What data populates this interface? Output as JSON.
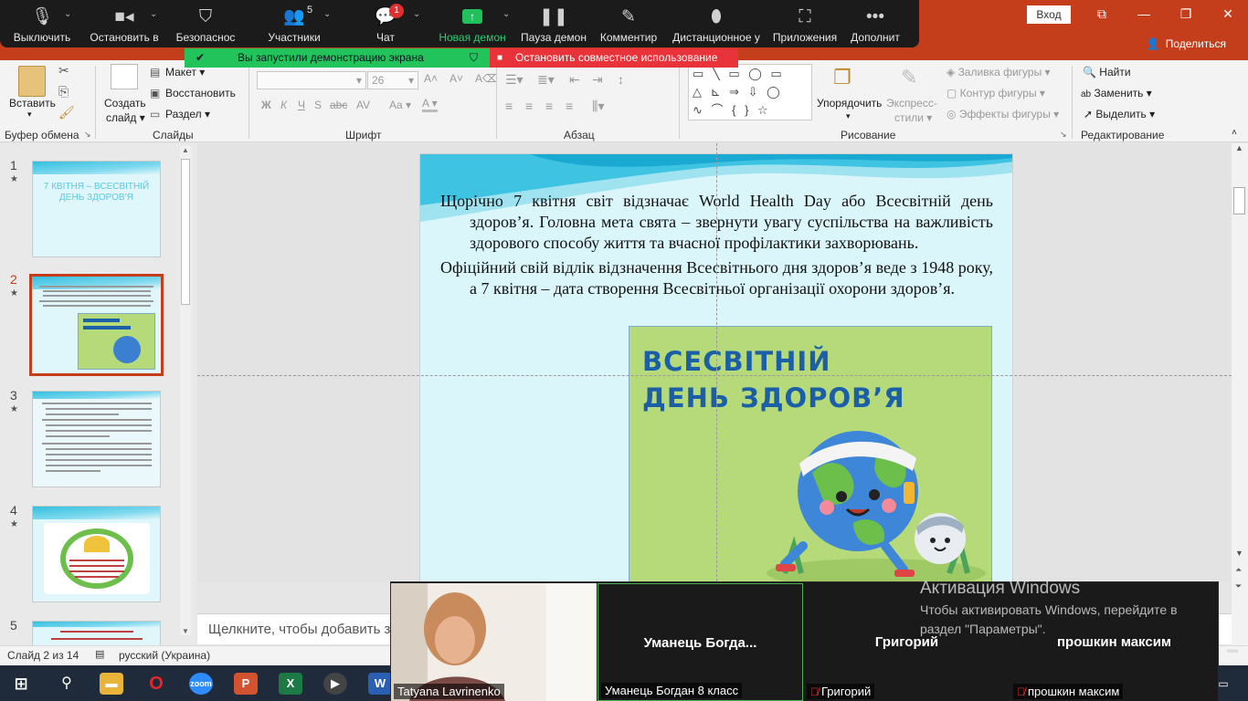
{
  "powerpoint": {
    "login_label": "Вход",
    "share_label": "Поделиться",
    "ribbon": {
      "clipboard": {
        "paste": "Вставить",
        "group": "Буфер обмена"
      },
      "slides": {
        "create_line1": "Создать",
        "create_line2": "слайд",
        "layout": "Макет",
        "reset": "Восстановить",
        "section": "Раздел",
        "group": "Слайды"
      },
      "font": {
        "size": "26",
        "group": "Шрифт",
        "bold": "Ж",
        "italic": "К",
        "underline": "Ч",
        "strike": "S",
        "abc": "abc",
        "case": "Aa"
      },
      "paragraph": {
        "group": "Абзац"
      },
      "drawing": {
        "arrange": "Упорядочить",
        "styles_line1": "Экспресс-",
        "styles_line2": "стили",
        "fill": "Заливка фигуры",
        "outline": "Контур фигуры",
        "effects": "Эффекты фигуры",
        "group": "Рисование"
      },
      "editing": {
        "find": "Найти",
        "replace": "Заменить",
        "select": "Выделить",
        "group": "Редактирование"
      }
    },
    "thumbnails": [
      {
        "num": "1",
        "title": "7 КВІТНЯ – ВСЕСВІТНІЙ ДЕНЬ ЗДОРОВ’Я"
      },
      {
        "num": "2"
      },
      {
        "num": "3"
      },
      {
        "num": "4"
      },
      {
        "num": "5"
      }
    ],
    "slide": {
      "paragraph1": "Щорічно 7 квітня світ відзначає World Health Day або Всесвітній день здоров’я. Головна мета свята – звернути увагу суспільства на важливість здорового способу життя та вчасної профілактики захворювань.",
      "paragraph2": "Офіційний свій відлік відзначення Всесвітнього дня здоров’я веде з 1948 року, а 7 квітня – дата створення Всесвітньої організації охорони здоров’я.",
      "poster_line1": "ВСЕСВІТНІЙ",
      "poster_line2": "ДЕНЬ ЗДОРОВ’Я"
    },
    "notes_placeholder": "Щелкните, чтобы добавить за",
    "status": {
      "slide_of": "Слайд 2 из 14",
      "language": "русский (Украина)"
    }
  },
  "zoom": {
    "toolbar": [
      {
        "label": "Выключить",
        "icon": "microphone-icon"
      },
      {
        "label": "Остановить в",
        "icon": "video-camera-icon"
      },
      {
        "label": "Безопаснос",
        "icon": "shield-icon"
      },
      {
        "label": "Участники",
        "icon": "participants-icon",
        "count": "5"
      },
      {
        "label": "Чат",
        "icon": "chat-icon",
        "badge": "1"
      },
      {
        "label": "Новая демон",
        "icon": "share-screen-icon"
      },
      {
        "label": "Пауза демон",
        "icon": "pause-icon"
      },
      {
        "label": "Комментир",
        "icon": "pencil-icon"
      },
      {
        "label": "Дистанционное у",
        "icon": "mouse-icon"
      },
      {
        "label": "Приложения",
        "icon": "apps-icon"
      },
      {
        "label": "Дополнит",
        "icon": "more-icon"
      }
    ],
    "notice_sharing": "Вы запустили демонстрацию экрана",
    "notice_stop": "Остановить совместное использование",
    "participants": [
      {
        "label": "Tatyana Lavrinenko",
        "big_name": ""
      },
      {
        "label": "Уманець Богдан 8 класс",
        "big_name": "Уманець Богда..."
      },
      {
        "label": "Григорий",
        "big_name": "Григорий"
      },
      {
        "label": "прошкин максим",
        "big_name": "прошкин максим"
      }
    ]
  },
  "windows": {
    "activation_title": "Активация Windows",
    "activation_line1": "Чтобы активировать Windows, перейдите в",
    "activation_line2": "раздел \"Параметры\"."
  },
  "colors": {
    "ppt_red": "#c43e1c",
    "zoom_green": "#21c35a",
    "zoom_red": "#e8333a",
    "poster_green": "#b6d97a",
    "poster_blue": "#1a5fa8"
  }
}
